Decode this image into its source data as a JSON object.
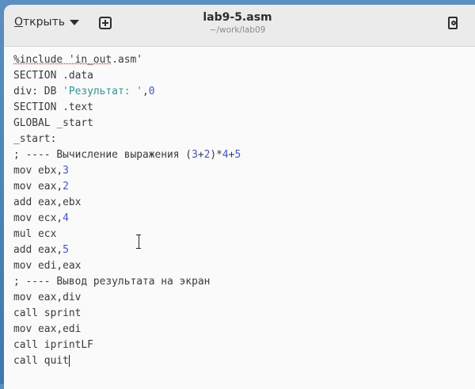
{
  "header": {
    "open_label_mnemonic": "О",
    "open_label_rest": "ткрыть",
    "title": "lab9-5.asm",
    "subtitle": "~/work/lab09"
  },
  "editor": {
    "lines": [
      [
        {
          "t": "%include 'in_out",
          "c": "spell"
        },
        {
          "t": ".asm'",
          "c": ""
        }
      ],
      [
        {
          "t": "SECTION .data",
          "c": ""
        }
      ],
      [
        {
          "t": "div: DB ",
          "c": ""
        },
        {
          "t": "'Результат: '",
          "c": "str"
        },
        {
          "t": ",",
          "c": ""
        },
        {
          "t": "0",
          "c": "num"
        }
      ],
      [
        {
          "t": "SECTION .text",
          "c": ""
        }
      ],
      [
        {
          "t": "GLOBAL _start",
          "c": ""
        }
      ],
      [
        {
          "t": "_start:",
          "c": ""
        }
      ],
      [
        {
          "t": "; ---- Вычисление выражения (",
          "c": ""
        },
        {
          "t": "3",
          "c": "num"
        },
        {
          "t": "+",
          "c": ""
        },
        {
          "t": "2",
          "c": "num"
        },
        {
          "t": ")*",
          "c": ""
        },
        {
          "t": "4",
          "c": "num"
        },
        {
          "t": "+",
          "c": ""
        },
        {
          "t": "5",
          "c": "num"
        }
      ],
      [
        {
          "t": "mov ebx,",
          "c": ""
        },
        {
          "t": "3",
          "c": "num"
        }
      ],
      [
        {
          "t": "mov eax,",
          "c": ""
        },
        {
          "t": "2",
          "c": "num"
        }
      ],
      [
        {
          "t": "add eax,ebx",
          "c": ""
        }
      ],
      [
        {
          "t": "mov ecx,",
          "c": ""
        },
        {
          "t": "4",
          "c": "num"
        }
      ],
      [
        {
          "t": "mul ecx",
          "c": ""
        }
      ],
      [
        {
          "t": "add eax,",
          "c": ""
        },
        {
          "t": "5",
          "c": "num"
        }
      ],
      [
        {
          "t": "mov edi,eax",
          "c": ""
        }
      ],
      [
        {
          "t": "; ---- Вывод результата на экран",
          "c": ""
        }
      ],
      [
        {
          "t": "mov eax,div",
          "c": ""
        }
      ],
      [
        {
          "t": "call sprint",
          "c": ""
        }
      ],
      [
        {
          "t": "mov eax,edi",
          "c": ""
        }
      ],
      [
        {
          "t": "call iprintLF",
          "c": ""
        }
      ],
      [
        {
          "t": "call quit",
          "c": ""
        }
      ]
    ]
  },
  "colors": {
    "number": "#4455c4",
    "string": "#2f9494",
    "text": "#3a3a3a"
  }
}
